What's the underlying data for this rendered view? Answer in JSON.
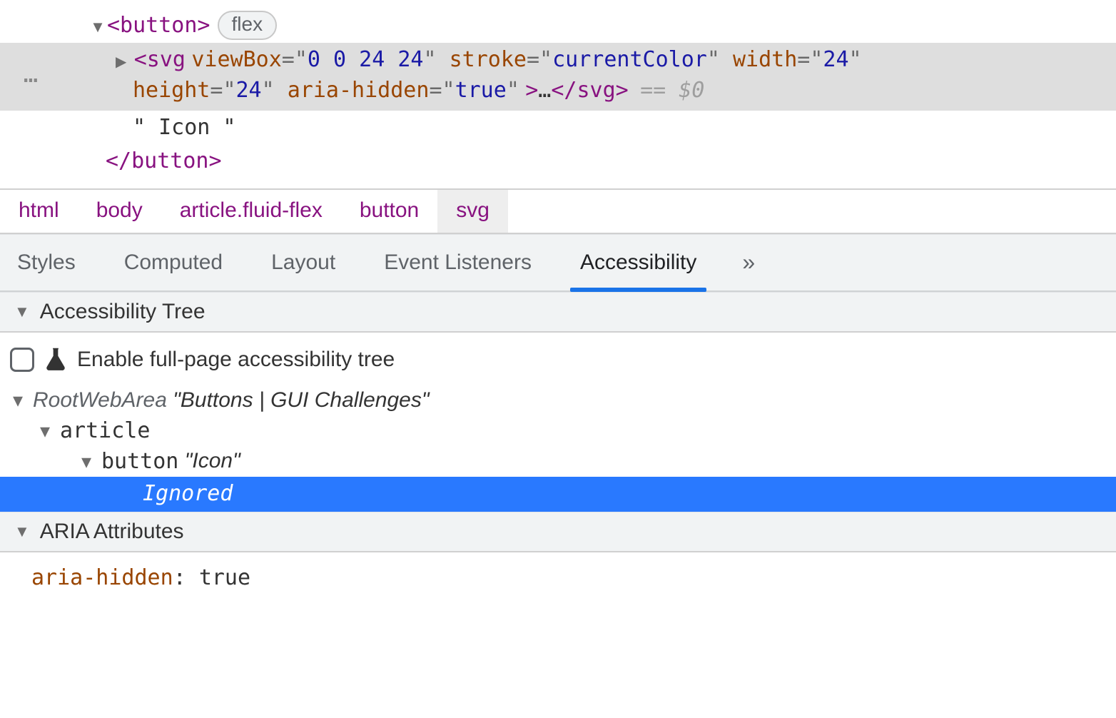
{
  "dom": {
    "button_open": "<button>",
    "flex_badge": "flex",
    "svg_open": "<svg",
    "svg_attrs": [
      {
        "name": "viewBox",
        "value": "0 0 24 24"
      },
      {
        "name": "stroke",
        "value": "currentColor"
      },
      {
        "name": "width",
        "value": "24"
      },
      {
        "name": "height",
        "value": "24"
      },
      {
        "name": "aria-hidden",
        "value": "true"
      }
    ],
    "svg_close_inline": "</svg>",
    "ellipsis": "…",
    "selected_marker": "== $0",
    "text_node": "\" Icon \"",
    "button_close": "</button>",
    "gutter_dots": "…"
  },
  "breadcrumb": [
    "html",
    "body",
    "article.fluid-flex",
    "button",
    "svg"
  ],
  "breadcrumb_selected_index": 4,
  "tabs": {
    "items": [
      "Styles",
      "Computed",
      "Layout",
      "Event Listeners",
      "Accessibility"
    ],
    "active_index": 4,
    "more_glyph": "»"
  },
  "sections": {
    "tree_header": "Accessibility Tree",
    "aria_header": "ARIA Attributes"
  },
  "enable_row": {
    "label": "Enable full-page accessibility tree"
  },
  "a11y_tree": {
    "root_role": "RootWebArea",
    "root_label": "\"Buttons | GUI Challenges\"",
    "article_role": "article",
    "button_role": "button",
    "button_label": "\"Icon\"",
    "ignored": "Ignored"
  },
  "aria_attrs": {
    "name": "aria-hidden",
    "value": "true"
  }
}
